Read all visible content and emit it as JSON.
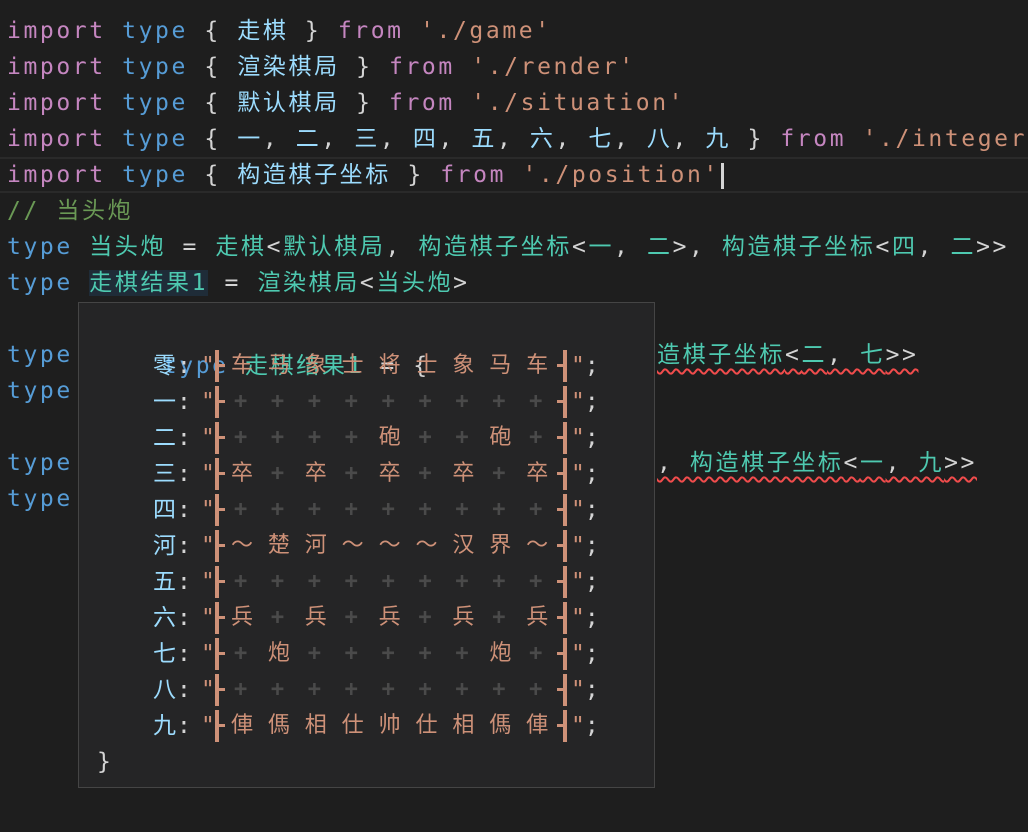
{
  "colors": {
    "background": "#1e1e1e",
    "keyword": "#c586c0",
    "type_keyword": "#569cd6",
    "identifier": "#9cdcfe",
    "type_name": "#4ec9b0",
    "string": "#ce9178",
    "comment": "#6a9955",
    "hover_bg": "#252526"
  },
  "editor": {
    "lines": [
      [
        [
          "import",
          "kw"
        ],
        [
          " ",
          "p"
        ],
        [
          "type",
          "ty"
        ],
        [
          " { ",
          "p"
        ],
        [
          "走棋",
          "id"
        ],
        [
          " } ",
          "p"
        ],
        [
          "from",
          "kw"
        ],
        [
          " ",
          "p"
        ],
        [
          "'./game'",
          "str"
        ]
      ],
      [
        [
          "import",
          "kw"
        ],
        [
          " ",
          "p"
        ],
        [
          "type",
          "ty"
        ],
        [
          " { ",
          "p"
        ],
        [
          "渲染棋局",
          "id"
        ],
        [
          " } ",
          "p"
        ],
        [
          "from",
          "kw"
        ],
        [
          " ",
          "p"
        ],
        [
          "'./render'",
          "str"
        ]
      ],
      [
        [
          "import",
          "kw"
        ],
        [
          " ",
          "p"
        ],
        [
          "type",
          "ty"
        ],
        [
          " { ",
          "p"
        ],
        [
          "默认棋局",
          "id"
        ],
        [
          " } ",
          "p"
        ],
        [
          "from",
          "kw"
        ],
        [
          " ",
          "p"
        ],
        [
          "'./situation'",
          "str"
        ]
      ],
      [
        [
          "import",
          "kw"
        ],
        [
          " ",
          "p"
        ],
        [
          "type",
          "ty"
        ],
        [
          " { ",
          "p"
        ],
        [
          "一",
          "id"
        ],
        [
          ", ",
          "p"
        ],
        [
          "二",
          "id"
        ],
        [
          ", ",
          "p"
        ],
        [
          "三",
          "id"
        ],
        [
          ", ",
          "p"
        ],
        [
          "四",
          "id"
        ],
        [
          ", ",
          "p"
        ],
        [
          "五",
          "id"
        ],
        [
          ", ",
          "p"
        ],
        [
          "六",
          "id"
        ],
        [
          ", ",
          "p"
        ],
        [
          "七",
          "id"
        ],
        [
          ", ",
          "p"
        ],
        [
          "八",
          "id"
        ],
        [
          ", ",
          "p"
        ],
        [
          "九",
          "id"
        ],
        [
          " } ",
          "p"
        ],
        [
          "from",
          "kw"
        ],
        [
          " ",
          "p"
        ],
        [
          "'./integer'",
          "str"
        ]
      ],
      [
        [
          "import",
          "kw"
        ],
        [
          " ",
          "p"
        ],
        [
          "type",
          "ty"
        ],
        [
          " { ",
          "p"
        ],
        [
          "构造棋子坐标",
          "id"
        ],
        [
          " } ",
          "p"
        ],
        [
          "from",
          "kw"
        ],
        [
          " ",
          "p"
        ],
        [
          "'./position'",
          "str"
        ]
      ],
      [
        [
          "// 当头炮",
          "cm"
        ]
      ],
      [
        [
          "type",
          "ty"
        ],
        [
          " ",
          "p"
        ],
        [
          "当头炮",
          "tn"
        ],
        [
          " = ",
          "p"
        ],
        [
          "走棋",
          "tn"
        ],
        [
          "<",
          "p"
        ],
        [
          "默认棋局",
          "tn"
        ],
        [
          ", ",
          "p"
        ],
        [
          "构造棋子坐标",
          "tn"
        ],
        [
          "<",
          "p"
        ],
        [
          "一",
          "tn"
        ],
        [
          ", ",
          "p"
        ],
        [
          "二",
          "tn"
        ],
        [
          ">, ",
          "p"
        ],
        [
          "构造棋子坐标",
          "tn"
        ],
        [
          "<",
          "p"
        ],
        [
          "四",
          "tn"
        ],
        [
          ", ",
          "p"
        ],
        [
          "二",
          "tn"
        ],
        [
          ">>",
          "p"
        ]
      ],
      [
        [
          "type",
          "ty"
        ],
        [
          " ",
          "p"
        ],
        [
          "走棋结果1",
          "tn"
        ],
        [
          " = ",
          "p"
        ],
        [
          "渲染棋局",
          "tn"
        ],
        [
          "<",
          "p"
        ],
        [
          "当头炮",
          "tn"
        ],
        [
          ">",
          "p"
        ]
      ],
      [],
      [
        [
          "type",
          "ty"
        ]
      ],
      [
        [
          "type",
          "ty"
        ]
      ],
      [],
      [
        [
          "type",
          "ty"
        ]
      ],
      [
        [
          "type",
          "ty"
        ]
      ]
    ],
    "hidden_tails": {
      "9": [
        [
          "造棋子坐标",
          "tn"
        ],
        [
          "<",
          "p"
        ],
        [
          "二",
          "tn"
        ],
        [
          ", ",
          "p"
        ],
        [
          "七",
          "tn"
        ],
        [
          ">>",
          "p"
        ]
      ],
      "12": [
        [
          ", ",
          "p"
        ],
        [
          "构造棋子坐标",
          "tn"
        ],
        [
          "<",
          "p"
        ],
        [
          "一",
          "tn"
        ],
        [
          ", ",
          "p"
        ],
        [
          "九",
          "tn"
        ],
        [
          ">>",
          "p"
        ]
      ]
    }
  },
  "hover": {
    "header": {
      "keyword": "type",
      "name": "走棋结果1",
      "rest": " = {"
    },
    "rows": [
      {
        "label": "零",
        "cells": "车马象士将士象马车"
      },
      {
        "label": "一",
        "cells": "+++++++++"
      },
      {
        "label": "二",
        "cells": "++++砲++砲+"
      },
      {
        "label": "三",
        "cells": "卒+卒+卒+卒+卒"
      },
      {
        "label": "四",
        "cells": "+++++++++"
      },
      {
        "label": "河",
        "cells": "～楚河～～～汉界～"
      },
      {
        "label": "五",
        "cells": "+++++++++"
      },
      {
        "label": "六",
        "cells": "兵+兵+兵+兵+兵"
      },
      {
        "label": "七",
        "cells": "+炮+++++炮+"
      },
      {
        "label": "八",
        "cells": "+++++++++"
      },
      {
        "label": "九",
        "cells": "俥傌相仕帅仕相傌俥"
      }
    ],
    "footer": "}"
  }
}
